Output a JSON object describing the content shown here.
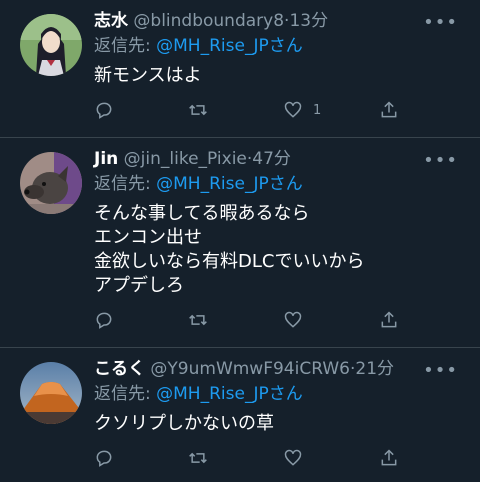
{
  "tweets": [
    {
      "name": "志水",
      "handle": "@blindboundary8",
      "time": "13分",
      "reply_label": "返信先:",
      "reply_to": "@MH_Rise_JPさん",
      "body": [
        "新モンスはよ"
      ],
      "like_count": "1"
    },
    {
      "name": "Jin",
      "handle": "@jin_like_Pixie",
      "time": "47分",
      "reply_label": "返信先:",
      "reply_to": "@MH_Rise_JPさん",
      "body": [
        "そんな事してる暇あるなら",
        "エンコン出せ",
        "金欲しいなら有料DLCでいいから",
        "アプデしろ"
      ],
      "like_count": ""
    },
    {
      "name": "こるく",
      "handle": "@Y9umWmwF94iCRW6",
      "time": "21分",
      "reply_label": "返信先:",
      "reply_to": "@MH_Rise_JPさん",
      "body": [
        "クソリプしかないの草"
      ],
      "like_count": ""
    }
  ],
  "separator": "·",
  "more_glyph": "•••",
  "colors": {
    "background": "#15202b",
    "secondary_text": "#8899a6",
    "link": "#1d9bf0",
    "divider": "#38444d"
  }
}
